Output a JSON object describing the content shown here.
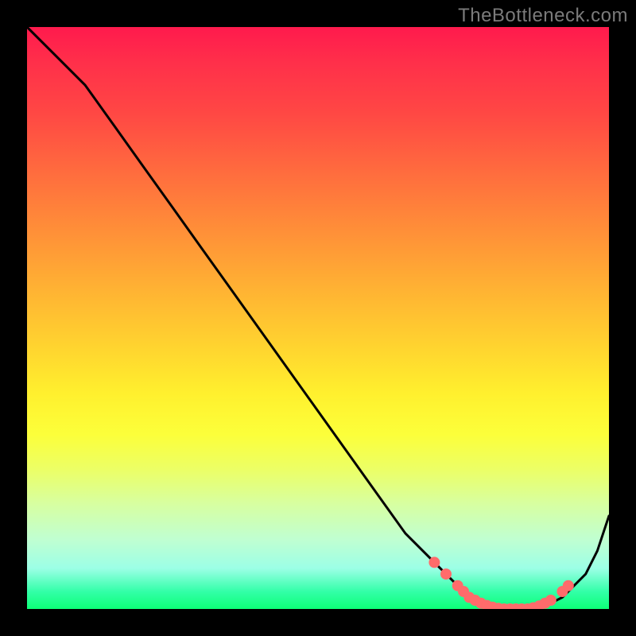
{
  "watermark": "TheBottleneck.com",
  "chart_data": {
    "type": "line",
    "title": "",
    "xlabel": "",
    "ylabel": "",
    "xlim": [
      0,
      100
    ],
    "ylim": [
      0,
      100
    ],
    "series": [
      {
        "name": "bottleneck-curve",
        "x": [
          0,
          5,
          10,
          15,
          20,
          25,
          30,
          35,
          40,
          45,
          50,
          55,
          60,
          65,
          70,
          72,
          74,
          76,
          78,
          80,
          82,
          84,
          86,
          88,
          90,
          92,
          94,
          96,
          98,
          100
        ],
        "y": [
          100,
          95,
          90,
          83,
          76,
          69,
          62,
          55,
          48,
          41,
          34,
          27,
          20,
          13,
          8,
          6,
          4,
          2,
          1,
          0,
          0,
          0,
          0,
          0,
          1,
          2,
          4,
          6,
          10,
          16
        ]
      }
    ],
    "highlight_points": {
      "name": "sweet-spot",
      "x": [
        70,
        72,
        74,
        75,
        76,
        77,
        78,
        79,
        80,
        81,
        82,
        83,
        84,
        85,
        86,
        87,
        88,
        89,
        90,
        92,
        93
      ],
      "y": [
        8,
        6,
        4,
        3,
        2,
        1.5,
        1,
        0.6,
        0.3,
        0.1,
        0,
        0,
        0,
        0,
        0,
        0.2,
        0.5,
        1,
        1.5,
        3,
        4
      ]
    },
    "background": {
      "type": "vertical-gradient",
      "stops": [
        {
          "pos": 0,
          "color": "#ff1a4d"
        },
        {
          "pos": 50,
          "color": "#ffd42f"
        },
        {
          "pos": 75,
          "color": "#fcff3a"
        },
        {
          "pos": 100,
          "color": "#0dff77"
        }
      ]
    }
  }
}
